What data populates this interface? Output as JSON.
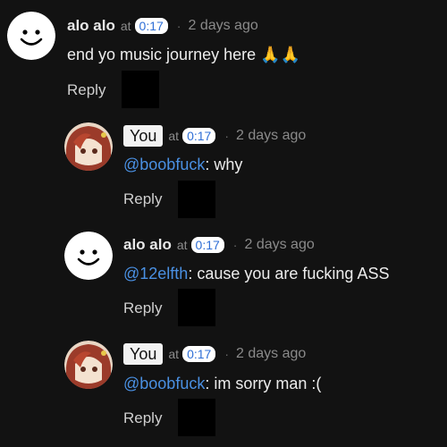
{
  "comments": [
    {
      "author": "alo alo",
      "at": "at",
      "timestamp": "0:17",
      "separator": "·",
      "ago": "2 days ago",
      "text": "end yo music journey here 🙏🙏",
      "reply": "Reply",
      "avatar": "smiley-avatar"
    },
    {
      "author": "You",
      "at": "at",
      "timestamp": "0:17",
      "separator": "·",
      "ago": "2 days ago",
      "mention": "@boobfuck",
      "text": ": why",
      "reply": "Reply",
      "avatar": "anime-avatar"
    },
    {
      "author": "alo alo",
      "at": "at",
      "timestamp": "0:17",
      "separator": "·",
      "ago": "2 days ago",
      "mention": "@12elfth",
      "text": ": cause you are fucking ASS",
      "reply": "Reply",
      "avatar": "smiley-avatar"
    },
    {
      "author": "You",
      "at": "at",
      "timestamp": "0:17",
      "separator": "·",
      "ago": "2 days ago",
      "mention": "@boobfuck",
      "text": ": im sorry man :(",
      "reply": "Reply",
      "avatar": "anime-avatar"
    }
  ],
  "colors": {
    "background": "#121212",
    "mention": "#4a90e2",
    "timestamp_text": "#2f6fd6"
  }
}
